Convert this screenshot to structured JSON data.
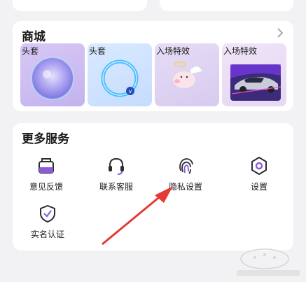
{
  "top_partial": {
    "left_text": "...",
    "right_text": "..."
  },
  "shop": {
    "title": "商城",
    "tiles": [
      {
        "label": "头套"
      },
      {
        "label": "头套"
      },
      {
        "label": "入场特效"
      },
      {
        "label": "入场特效"
      }
    ]
  },
  "services": {
    "title": "更多服务",
    "items": [
      {
        "label": "意见反馈",
        "icon": "feedback-icon"
      },
      {
        "label": "联系客服",
        "icon": "headset-icon"
      },
      {
        "label": "隐私设置",
        "icon": "fingerprint-icon"
      },
      {
        "label": "设置",
        "icon": "settings-hexagon-icon"
      },
      {
        "label": "实名认证",
        "icon": "shield-check-icon"
      }
    ]
  },
  "colors": {
    "accent_purple": "#7b4bd6",
    "annotation_red": "#e53935"
  }
}
